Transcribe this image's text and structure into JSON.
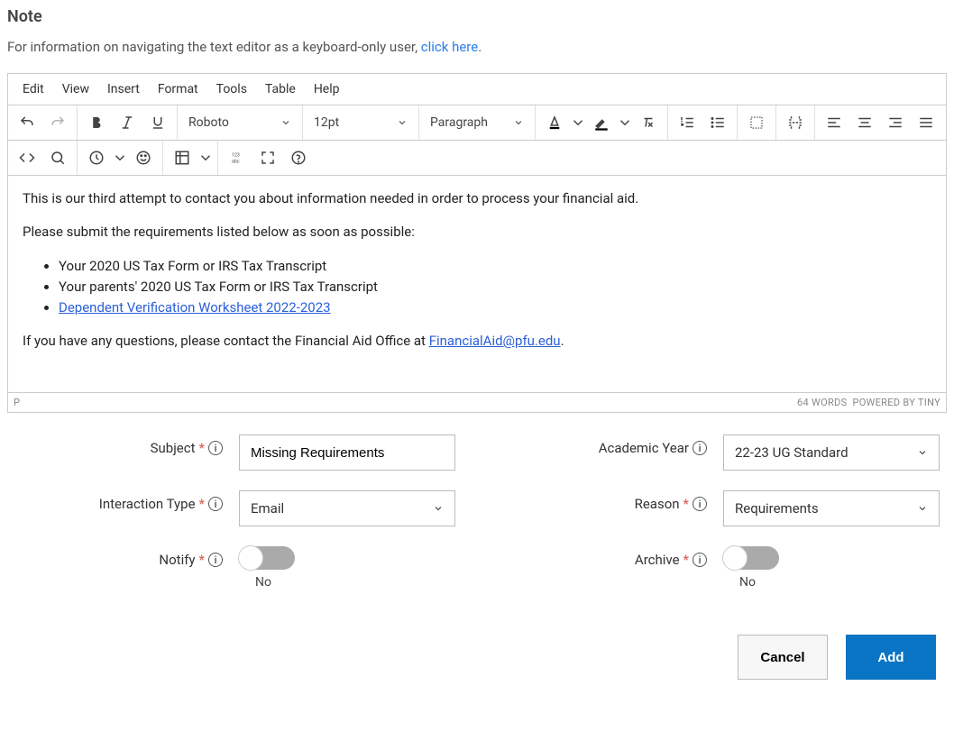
{
  "title": "Note",
  "intro": {
    "text": "For information on navigating the text editor as a keyboard-only user, ",
    "link": "click here",
    "suffix": "."
  },
  "menubar": [
    "Edit",
    "View",
    "Insert",
    "Format",
    "Tools",
    "Table",
    "Help"
  ],
  "toolbar": {
    "font": "Roboto",
    "size": "12pt",
    "block": "Paragraph"
  },
  "content": {
    "p1": "This is our third attempt to contact you about information needed in order to process your financial aid.",
    "p2": "Please submit the requirements listed below as soon as possible:",
    "li1": "Your 2020 US Tax Form or IRS Tax Transcript",
    "li2": "Your parents' 2020 US Tax Form or IRS Tax Transcript",
    "li3": "Dependent Verification Worksheet 2022-2023",
    "p3_pre": "If you have any questions, please contact the Financial Aid Office at ",
    "p3_link": "FinancialAid@pfu.edu",
    "p3_suf": "."
  },
  "status": {
    "path": "P",
    "words": "64 WORDS",
    "powered": "POWERED BY TINY"
  },
  "form": {
    "subject": {
      "label": "Subject",
      "value": "Missing Requirements"
    },
    "academic_year": {
      "label": "Academic Year",
      "value": "22-23 UG Standard"
    },
    "interaction_type": {
      "label": "Interaction Type",
      "value": "Email"
    },
    "reason": {
      "label": "Reason",
      "value": "Requirements"
    },
    "notify": {
      "label": "Notify",
      "value": "No"
    },
    "archive": {
      "label": "Archive",
      "value": "No"
    }
  },
  "actions": {
    "cancel": "Cancel",
    "add": "Add"
  }
}
